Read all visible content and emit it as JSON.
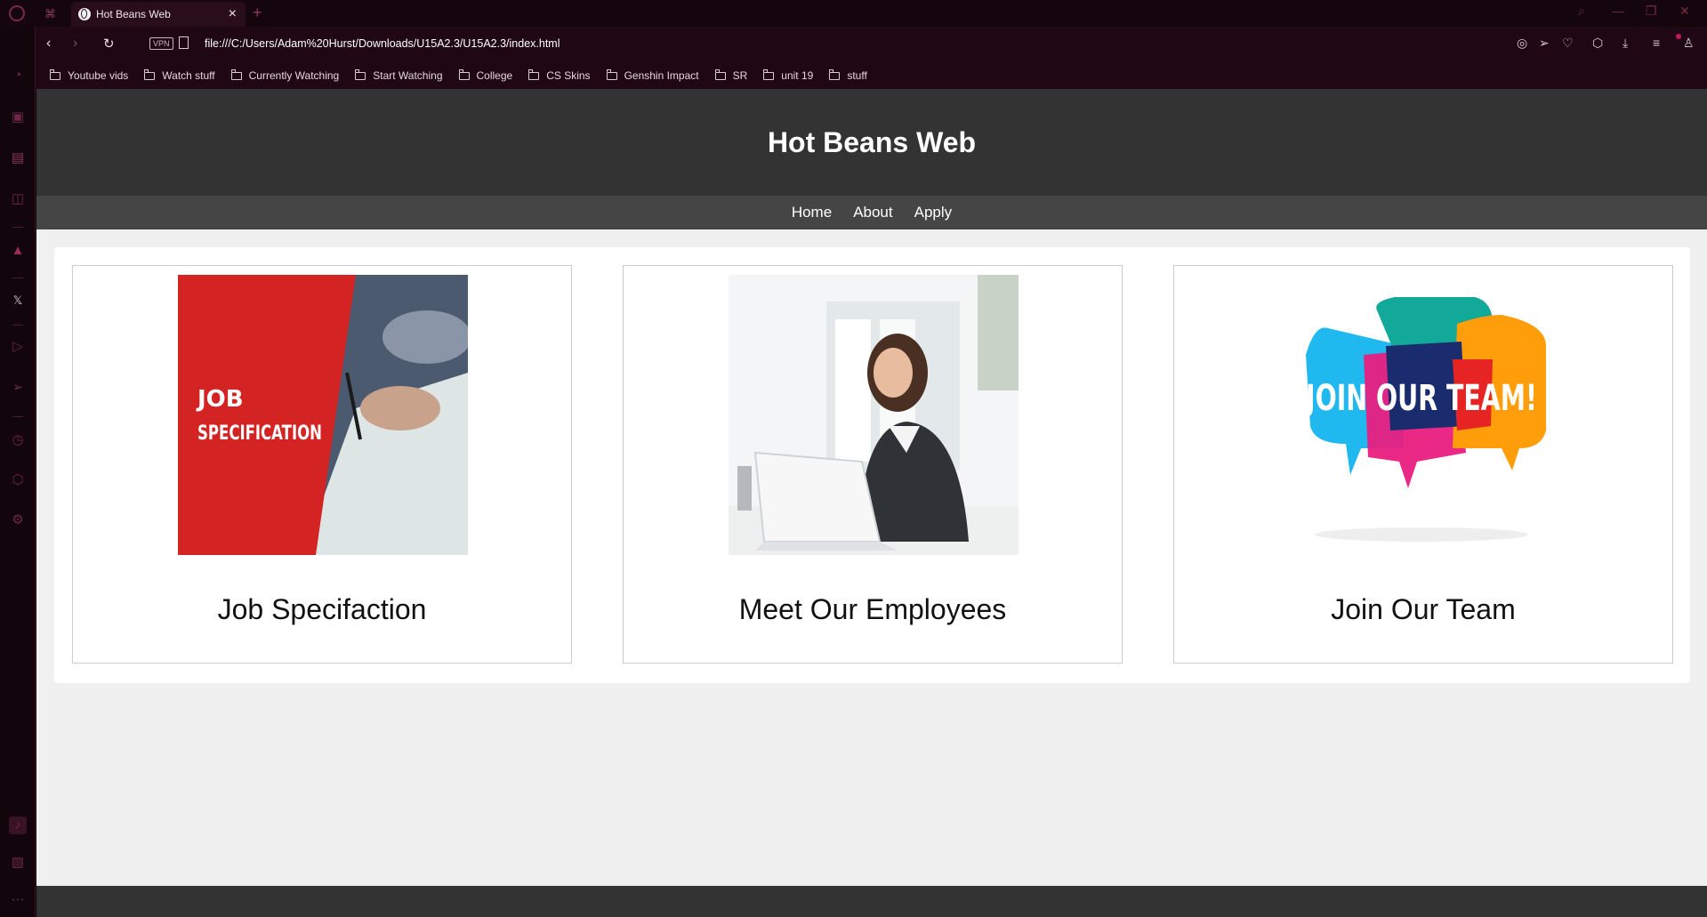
{
  "browser": {
    "tab_title": "Hot Beans Web",
    "url": "file:///C:/Users/Adam%20Hurst/Downloads/U15A2.3/U15A2.3/index.html",
    "vpn_label": "VPN",
    "bookmarks": [
      "Youtube vids",
      "Watch stuff",
      "Currently Watching",
      "Start Watching",
      "College",
      "CS Skins",
      "Genshin Impact",
      "SR",
      "unit 19",
      "stuff"
    ]
  },
  "site": {
    "title": "Hot Beans Web",
    "nav": [
      "Home",
      "About",
      "Apply"
    ],
    "cards": [
      {
        "caption": "Job Specifaction",
        "image_text_1": "JOB",
        "image_text_2": "SPECIFICATION"
      },
      {
        "caption": "Meet Our Employees"
      },
      {
        "caption": "Join Our Team",
        "image_text": "JOIN OUR TEAM!"
      }
    ]
  },
  "colors": {
    "header_bg": "#333333",
    "nav_bg": "#454545",
    "page_bg": "#f0f0f0",
    "browser_accent": "#c2185b"
  }
}
